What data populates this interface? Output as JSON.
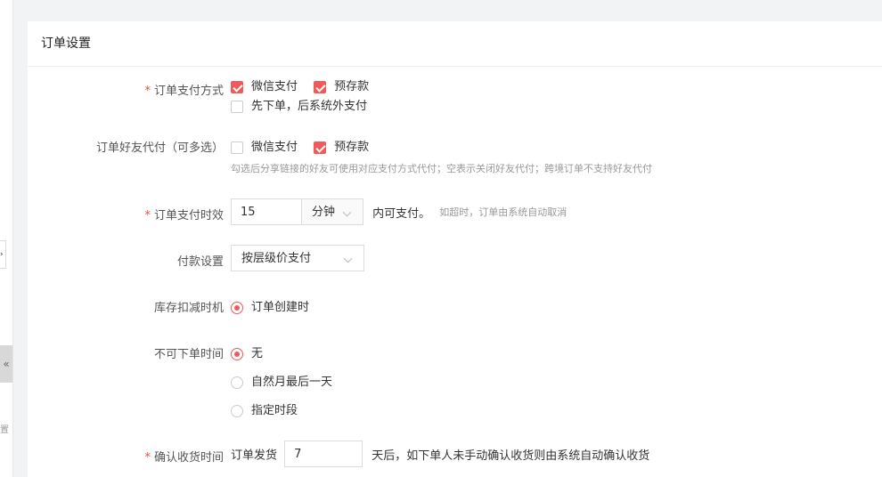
{
  "sidebar": {
    "collapse_glyph": "«",
    "partial_char": "置"
  },
  "panel": {
    "title": "订单设置"
  },
  "pay_method": {
    "label": "订单支付方式",
    "options": [
      {
        "label": "微信支付",
        "checked": true
      },
      {
        "label": "预存款",
        "checked": true
      },
      {
        "label": "先下单，后系统外支付",
        "checked": false
      }
    ]
  },
  "friend_pay": {
    "label": "订单好友代付（可多选）",
    "options": [
      {
        "label": "微信支付",
        "checked": false
      },
      {
        "label": "预存款",
        "checked": true
      }
    ],
    "hint": "勾选后分享链接的好友可使用对应支付方式代付；空表示关闭好友代付；跨境订单不支持好友代付"
  },
  "pay_timeout": {
    "label": "订单支付时效",
    "value": "15",
    "unit": "分钟",
    "suffix": "内可支付。",
    "hint": "如超时，订单由系统自动取消"
  },
  "payment_setting": {
    "label": "付款设置",
    "value": "按层级价支付"
  },
  "stock_deduct": {
    "label": "库存扣减时机",
    "options": [
      {
        "label": "订单创建时",
        "selected": true
      }
    ]
  },
  "no_order_time": {
    "label": "不可下单时间",
    "options": [
      {
        "label": "无",
        "selected": true
      },
      {
        "label": "自然月最后一天",
        "selected": false
      },
      {
        "label": "指定时段",
        "selected": false
      }
    ]
  },
  "confirm_receipt": {
    "label": "确认收货时间",
    "prefix": "订单发货",
    "value": "7",
    "suffix": "天后，如下单人未手动确认收货则由系统自动确认收货"
  },
  "colors": {
    "accent": "#f05a5a",
    "required": "#e74c3c"
  }
}
